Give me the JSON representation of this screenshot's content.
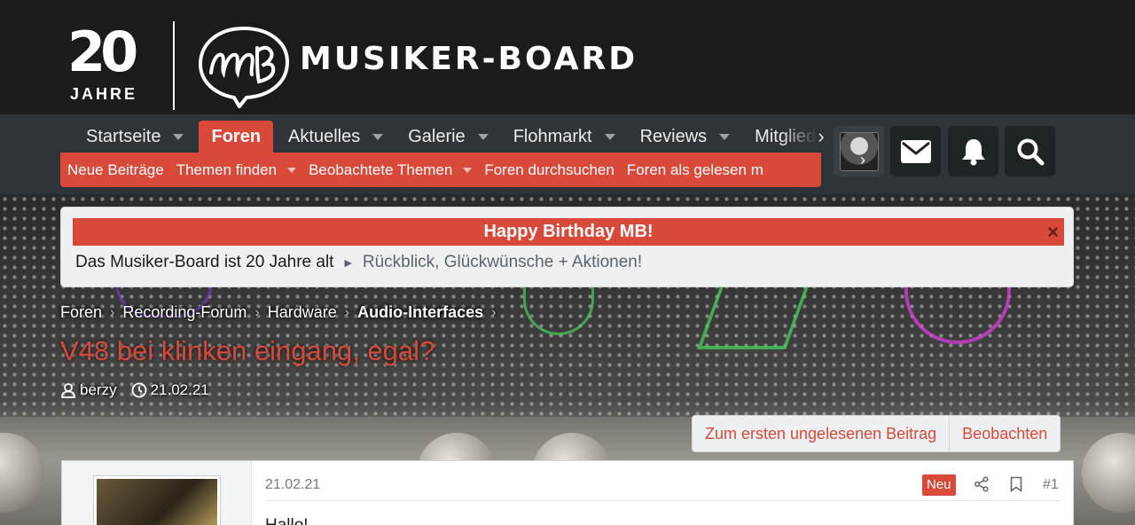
{
  "header": {
    "anniversary_number": "20",
    "anniversary_word": "JAHRE",
    "brand_name": "MUSIKER-BOARD"
  },
  "nav": {
    "tabs": [
      {
        "label": "Startseite",
        "has_dropdown": true
      },
      {
        "label": "Foren",
        "active": true
      },
      {
        "label": "Aktuelles",
        "has_dropdown": true
      },
      {
        "label": "Galerie",
        "has_dropdown": true
      },
      {
        "label": "Flohmarkt",
        "has_dropdown": true
      },
      {
        "label": "Reviews",
        "has_dropdown": true
      },
      {
        "label": "Mitglied"
      }
    ],
    "subnav": [
      {
        "label": "Neue Beiträge"
      },
      {
        "label": "Themen finden",
        "has_dropdown": true
      },
      {
        "label": "Beobachtete Themen",
        "has_dropdown": true
      },
      {
        "label": "Foren durchsuchen"
      },
      {
        "label": "Foren als gelesen m"
      }
    ],
    "icons": [
      "avatar",
      "envelope-icon",
      "bell-icon",
      "search-icon"
    ]
  },
  "notice": {
    "title": "Happy Birthday MB!",
    "close": "×",
    "text": "Das Musiker-Board ist 20 Jahre alt",
    "arrow": "►",
    "link": "Rückblick, Glückwünsche + Aktionen!"
  },
  "breadcrumb": [
    "Foren",
    "Recording-Forum",
    "Hardware",
    "Audio-Interfaces"
  ],
  "thread": {
    "title": "V48 bei klinken eingang, egal?",
    "author": "berzy",
    "date": "21.02.21"
  },
  "actions": {
    "first_unread": "Zum ersten ungelesenen Beitrag",
    "watch": "Beobachten"
  },
  "post": {
    "date": "21.02.21",
    "badge": "Neu",
    "number": "#1",
    "text": "Hallo!"
  },
  "colors": {
    "accent": "#d9493a",
    "header_bg": "#1b1b1b",
    "nav_bg": "#2f3438",
    "notice_bg": "#eef0f1"
  }
}
